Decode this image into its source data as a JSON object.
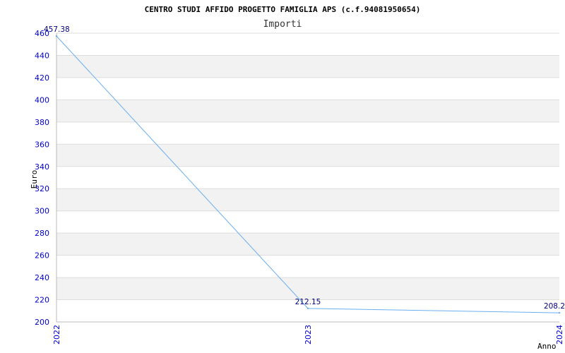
{
  "chart_data": {
    "type": "line",
    "title": "CENTRO STUDI AFFIDO PROGETTO FAMIGLIA APS (c.f.94081950654)",
    "subtitle": "Importi",
    "xlabel": "Anno",
    "ylabel": "Euro",
    "x": [
      "2022",
      "2023",
      "2024"
    ],
    "series": [
      {
        "values": [
          457.38,
          212.15,
          208.2
        ]
      }
    ],
    "data_labels": [
      "457.38",
      "212.15",
      "208.2"
    ],
    "ylim": [
      200,
      460
    ],
    "yticks": [
      "200",
      "220",
      "240",
      "260",
      "280",
      "300",
      "320",
      "340",
      "360",
      "380",
      "400",
      "420",
      "440",
      "460"
    ],
    "grid": "horizontal alternating bands",
    "colors": {
      "line": "#6aaef0",
      "band": "#f2f2f2",
      "gridline": "#dddddd",
      "tick_text": "#0000cc",
      "data_label": "#000080"
    }
  }
}
